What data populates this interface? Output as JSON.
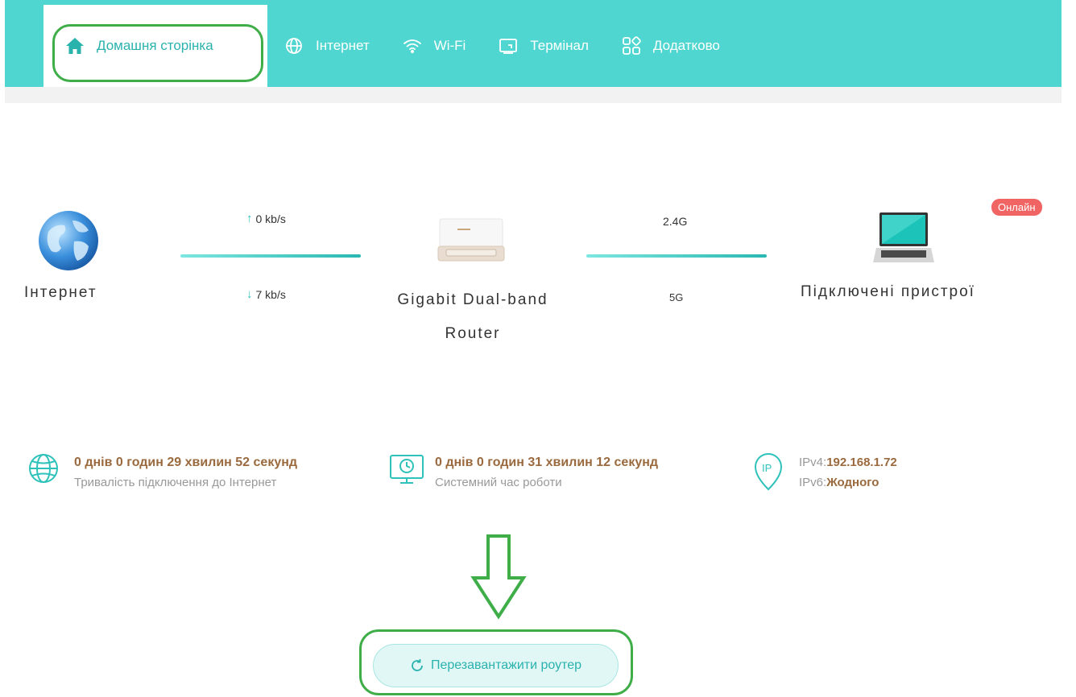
{
  "nav": {
    "tabs": [
      {
        "label": "Домашня сторінка",
        "icon": "home-icon",
        "active": true
      },
      {
        "label": "Інтернет",
        "icon": "globe-icon",
        "active": false
      },
      {
        "label": "Wi-Fi",
        "icon": "wifi-icon",
        "active": false
      },
      {
        "label": "Термінал",
        "icon": "terminal-icon",
        "active": false
      },
      {
        "label": "Додатково",
        "icon": "apps-icon",
        "active": false
      }
    ]
  },
  "topology": {
    "internet_label": "Інтернет",
    "upload_rate": "0 kb/s",
    "download_rate": "7 kb/s",
    "router_label": "Gigabit Dual-band Router",
    "band_24": "2.4G",
    "band_5": "5G",
    "devices_label": "Підключені пристрої",
    "online_badge": "Онлайн"
  },
  "info": {
    "connection_duration": "0 днів 0 годин 29 хвилин 52 секунд",
    "connection_duration_label": "Тривалість підключення до Інтернет",
    "system_uptime": "0 днів 0 годин 31 хвилин 12 секунд",
    "system_uptime_label": "Системний час роботи",
    "ipv4_label": "IPv4:",
    "ipv4_value": "192.168.1.72",
    "ipv6_label": "IPv6:",
    "ipv6_value": "Жодного"
  },
  "actions": {
    "reboot_label": "Перезавантажити роутер"
  },
  "colors": {
    "accent": "#4fd6d0",
    "accent_dark": "#2ab2ad",
    "value_brown": "#9a6a3e",
    "badge_red": "#f06464",
    "annotation_green": "#3fae49"
  }
}
